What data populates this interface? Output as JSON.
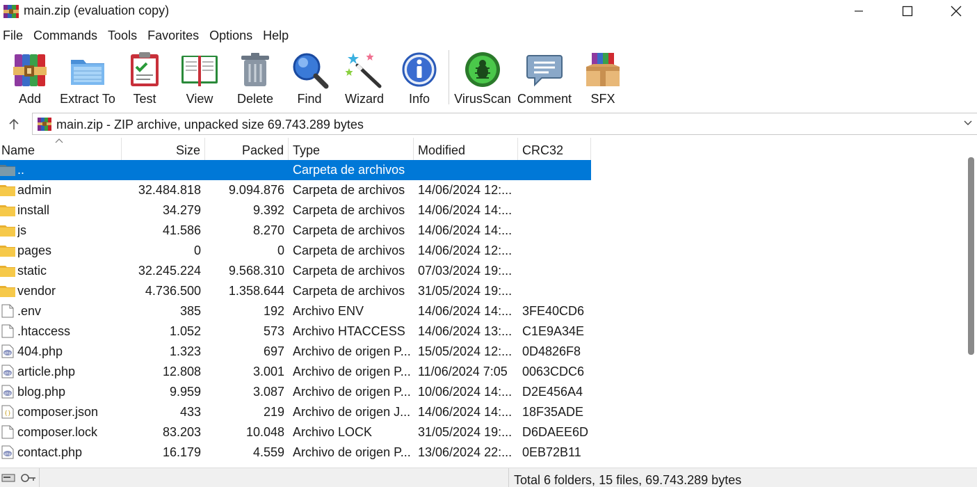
{
  "window": {
    "title": "main.zip (evaluation copy)"
  },
  "menu": [
    "File",
    "Commands",
    "Tools",
    "Favorites",
    "Options",
    "Help"
  ],
  "toolbar": {
    "add": "Add",
    "extract_to": "Extract To",
    "test": "Test",
    "view": "View",
    "delete": "Delete",
    "find": "Find",
    "wizard": "Wizard",
    "info": "Info",
    "virusscan": "VirusScan",
    "comment": "Comment",
    "sfx": "SFX"
  },
  "address": {
    "text": "main.zip - ZIP archive, unpacked size 69.743.289 bytes"
  },
  "columns": {
    "name": "Name",
    "size": "Size",
    "packed": "Packed",
    "type": "Type",
    "modified": "Modified",
    "crc": "CRC32"
  },
  "files": [
    {
      "icon": "parent-folder-icon",
      "name": "..",
      "size": "",
      "packed": "",
      "type": "Carpeta de archivos",
      "modified": "",
      "crc": "",
      "selected": true
    },
    {
      "icon": "folder-icon",
      "name": "admin",
      "size": "32.484.818",
      "packed": "9.094.876",
      "type": "Carpeta de archivos",
      "modified": "14/06/2024 12:...",
      "crc": ""
    },
    {
      "icon": "folder-icon",
      "name": "install",
      "size": "34.279",
      "packed": "9.392",
      "type": "Carpeta de archivos",
      "modified": "14/06/2024 14:...",
      "crc": ""
    },
    {
      "icon": "folder-icon",
      "name": "js",
      "size": "41.586",
      "packed": "8.270",
      "type": "Carpeta de archivos",
      "modified": "14/06/2024 14:...",
      "crc": ""
    },
    {
      "icon": "folder-icon",
      "name": "pages",
      "size": "0",
      "packed": "0",
      "type": "Carpeta de archivos",
      "modified": "14/06/2024 12:...",
      "crc": ""
    },
    {
      "icon": "folder-icon",
      "name": "static",
      "size": "32.245.224",
      "packed": "9.568.310",
      "type": "Carpeta de archivos",
      "modified": "07/03/2024 19:...",
      "crc": ""
    },
    {
      "icon": "folder-icon",
      "name": "vendor",
      "size": "4.736.500",
      "packed": "1.358.644",
      "type": "Carpeta de archivos",
      "modified": "31/05/2024 19:...",
      "crc": ""
    },
    {
      "icon": "file-icon",
      "name": ".env",
      "size": "385",
      "packed": "192",
      "type": "Archivo ENV",
      "modified": "14/06/2024 14:...",
      "crc": "3FE40CD6"
    },
    {
      "icon": "file-icon",
      "name": ".htaccess",
      "size": "1.052",
      "packed": "573",
      "type": "Archivo HTACCESS",
      "modified": "14/06/2024 13:...",
      "crc": "C1E9A34E"
    },
    {
      "icon": "php-file-icon",
      "name": "404.php",
      "size": "1.323",
      "packed": "697",
      "type": "Archivo de origen P...",
      "modified": "15/05/2024 12:...",
      "crc": "0D4826F8"
    },
    {
      "icon": "php-file-icon",
      "name": "article.php",
      "size": "12.808",
      "packed": "3.001",
      "type": "Archivo de origen P...",
      "modified": "11/06/2024 7:05",
      "crc": "0063CDC6"
    },
    {
      "icon": "php-file-icon",
      "name": "blog.php",
      "size": "9.959",
      "packed": "3.087",
      "type": "Archivo de origen P...",
      "modified": "10/06/2024 14:...",
      "crc": "D2E456A4"
    },
    {
      "icon": "json-file-icon",
      "name": "composer.json",
      "size": "433",
      "packed": "219",
      "type": "Archivo de origen J...",
      "modified": "14/06/2024 14:...",
      "crc": "18F35ADE"
    },
    {
      "icon": "file-icon",
      "name": "composer.lock",
      "size": "83.203",
      "packed": "10.048",
      "type": "Archivo LOCK",
      "modified": "31/05/2024 19:...",
      "crc": "D6DAEE6D"
    },
    {
      "icon": "php-file-icon",
      "name": "contact.php",
      "size": "16.179",
      "packed": "4.559",
      "type": "Archivo de origen P...",
      "modified": "13/06/2024 22:...",
      "crc": "0EB72B11"
    }
  ],
  "status": {
    "summary": "Total 6 folders, 15 files, 69.743.289 bytes"
  },
  "colors": {
    "selection": "#0078d7",
    "folder": "#f6c94a"
  }
}
